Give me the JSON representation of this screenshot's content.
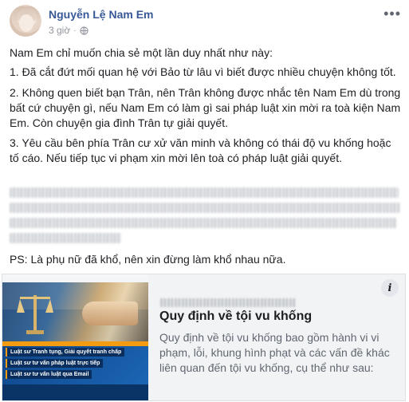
{
  "post": {
    "author": "Nguyễn Lệ Nam Em",
    "time": "3 giờ",
    "separator": "·",
    "more_label": "•••",
    "paragraphs": [
      "Nam Em chỉ muốn chia sẻ một lần duy nhất như này:",
      "1. Đã cắt đứt mối quan hệ với Bảo từ lâu vì biết được nhiều chuyện không tốt.",
      "2. Không quen biết bạn Trân, nên Trân không được nhắc tên Nam Em dù trong bất cứ chuyện gì, nếu Nam Em có làm gì sai pháp luật xin mời ra toà kiện Nam Em. Còn chuyện gia đình Trân tự giải quyết.",
      "3. Yêu cầu bên phía Trân cư xử văn minh và không có thái độ vu khống hoặc tố cáo. Nếu tiếp tục vi phạm xin mời lên toà có pháp luật giải quyết."
    ],
    "ps": "PS: Là phụ nữ đã khổ, nên xin đừng làm khổ nhau nữa."
  },
  "link_preview": {
    "info_label": "i",
    "title": "Quy định về tội vu khống",
    "description": "Quy định về tội vu khống bao gồm hành vi vi phạm, lỗi, khung hình phạt và các vấn đề khác liên quan đến tội vu khống, cụ thể như sau:",
    "thumbnail_badges": [
      "Luật sư Tranh tụng, Giải quyết tranh chấp",
      "Luật sư tư vấn pháp luật trực tiếp",
      "Luật sư tư vấn luật qua Email"
    ]
  },
  "colors": {
    "author": "#385898",
    "meta": "#90949c",
    "text": "#1c1e21",
    "preview_bg": "#f2f3f5"
  },
  "icons": [
    "more-options-icon",
    "globe-icon",
    "info-icon"
  ]
}
